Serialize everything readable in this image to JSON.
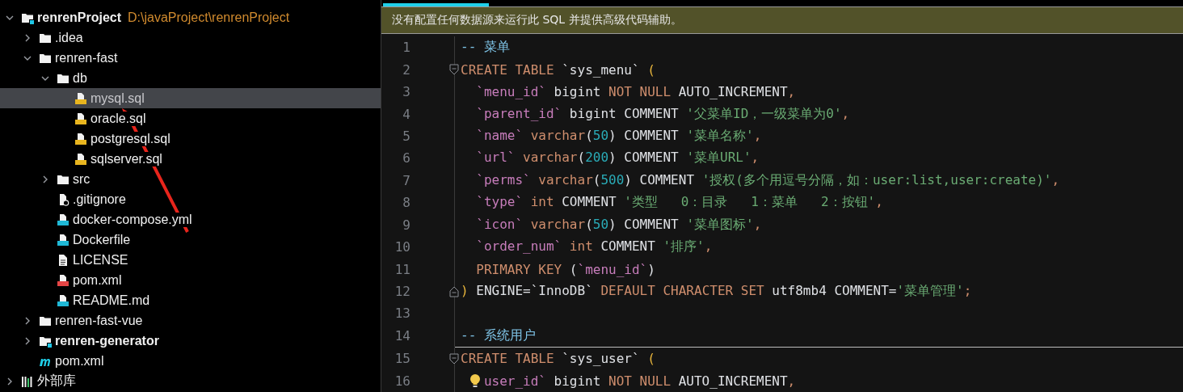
{
  "tree": [
    {
      "label": "renrenProject",
      "path": "D:\\javaProject\\renrenProject",
      "kind": "module",
      "expanded": true,
      "selected": false,
      "children": [
        {
          "label": ".idea",
          "kind": "folder",
          "expanded": false,
          "selected": false
        },
        {
          "label": "renren-fast",
          "kind": "folder",
          "expanded": true,
          "selected": false,
          "children": [
            {
              "label": "db",
              "kind": "folder",
              "expanded": true,
              "selected": false,
              "children": [
                {
                  "label": "mysql.sql",
                  "kind": "sql",
                  "selected": true
                },
                {
                  "label": "oracle.sql",
                  "kind": "sql",
                  "selected": false
                },
                {
                  "label": "postgresql.sql",
                  "kind": "sql",
                  "selected": false
                },
                {
                  "label": "sqlserver.sql",
                  "kind": "sql",
                  "selected": false
                }
              ]
            },
            {
              "label": "src",
              "kind": "folder",
              "expanded": false,
              "selected": false
            },
            {
              "label": ".gitignore",
              "kind": "ignore",
              "selected": false
            },
            {
              "label": "docker-compose.yml",
              "kind": "compose",
              "selected": false
            },
            {
              "label": "Dockerfile",
              "kind": "docker",
              "selected": false
            },
            {
              "label": "LICENSE",
              "kind": "text",
              "selected": false
            },
            {
              "label": "pom.xml",
              "kind": "xml",
              "selected": false
            },
            {
              "label": "README.md",
              "kind": "markdown",
              "selected": false
            }
          ]
        },
        {
          "label": "renren-fast-vue",
          "kind": "folder",
          "expanded": false,
          "selected": false
        },
        {
          "label": "renren-generator",
          "kind": "module",
          "expanded": false,
          "selected": false
        },
        {
          "label": "pom.xml",
          "kind": "maven",
          "selected": false
        }
      ]
    },
    {
      "label": "外部库",
      "kind": "library",
      "expanded": false,
      "selected": false
    }
  ],
  "banner": "没有配置任何数据源来运行此 SQL 并提供高级代码辅助。",
  "lines": [
    {
      "number": "1",
      "tokens": [
        {
          "kind": "comment",
          "t": "-- 菜单"
        }
      ]
    },
    {
      "number": "2",
      "fold_start": true,
      "tokens": [
        {
          "kind": "kw",
          "t": "CREATE TABLE "
        },
        {
          "kind": "plain",
          "t": "`sys_menu` "
        },
        {
          "kind": "paren",
          "t": "("
        }
      ]
    },
    {
      "number": "3",
      "tokens": [
        {
          "kind": "ident",
          "t": "  `menu_id`"
        },
        {
          "kind": "plain",
          "t": " bigint "
        },
        {
          "kind": "kw",
          "t": "NOT NULL"
        },
        {
          "kind": "plain",
          "t": " AUTO_INCREMENT"
        },
        {
          "kind": "punct",
          "t": ","
        }
      ]
    },
    {
      "number": "4",
      "tokens": [
        {
          "kind": "ident",
          "t": "  `parent_id`"
        },
        {
          "kind": "plain",
          "t": " bigint COMMENT "
        },
        {
          "kind": "str",
          "t": "'父菜单ID，一级菜单为0'"
        },
        {
          "kind": "punct",
          "t": ","
        }
      ]
    },
    {
      "number": "5",
      "tokens": [
        {
          "kind": "ident",
          "t": "  `name`"
        },
        {
          "kind": "kw",
          "t": " varchar"
        },
        {
          "kind": "plain",
          "t": "("
        },
        {
          "kind": "num",
          "t": "50"
        },
        {
          "kind": "plain",
          "t": ")"
        },
        {
          "kind": "plain",
          "t": " COMMENT "
        },
        {
          "kind": "str",
          "t": "'菜单名称'"
        },
        {
          "kind": "punct",
          "t": ","
        }
      ]
    },
    {
      "number": "6",
      "tokens": [
        {
          "kind": "ident",
          "t": "  `url`"
        },
        {
          "kind": "kw",
          "t": " varchar"
        },
        {
          "kind": "plain",
          "t": "("
        },
        {
          "kind": "num",
          "t": "200"
        },
        {
          "kind": "plain",
          "t": ")"
        },
        {
          "kind": "plain",
          "t": " COMMENT "
        },
        {
          "kind": "str",
          "t": "'菜单URL'"
        },
        {
          "kind": "punct",
          "t": ","
        }
      ]
    },
    {
      "number": "7",
      "tokens": [
        {
          "kind": "ident",
          "t": "  `perms`"
        },
        {
          "kind": "kw",
          "t": " varchar"
        },
        {
          "kind": "plain",
          "t": "("
        },
        {
          "kind": "num",
          "t": "500"
        },
        {
          "kind": "plain",
          "t": ")"
        },
        {
          "kind": "plain",
          "t": " COMMENT "
        },
        {
          "kind": "str",
          "t": "'授权(多个用逗号分隔，如：user:list,user:create)'"
        },
        {
          "kind": "punct",
          "t": ","
        }
      ]
    },
    {
      "number": "8",
      "tokens": [
        {
          "kind": "ident",
          "t": "  `type`"
        },
        {
          "kind": "kw",
          "t": " int"
        },
        {
          "kind": "plain",
          "t": " COMMENT "
        },
        {
          "kind": "str",
          "t": "'类型   0：目录   1：菜单   2：按钮'"
        },
        {
          "kind": "punct",
          "t": ","
        }
      ]
    },
    {
      "number": "9",
      "tokens": [
        {
          "kind": "ident",
          "t": "  `icon`"
        },
        {
          "kind": "kw",
          "t": " varchar"
        },
        {
          "kind": "plain",
          "t": "("
        },
        {
          "kind": "num",
          "t": "50"
        },
        {
          "kind": "plain",
          "t": ")"
        },
        {
          "kind": "plain",
          "t": " COMMENT "
        },
        {
          "kind": "str",
          "t": "'菜单图标'"
        },
        {
          "kind": "punct",
          "t": ","
        }
      ]
    },
    {
      "number": "10",
      "tokens": [
        {
          "kind": "ident",
          "t": "  `order_num`"
        },
        {
          "kind": "kw",
          "t": " int"
        },
        {
          "kind": "plain",
          "t": " COMMENT "
        },
        {
          "kind": "str",
          "t": "'排序'"
        },
        {
          "kind": "punct",
          "t": ","
        }
      ]
    },
    {
      "number": "11",
      "tokens": [
        {
          "kind": "kw",
          "t": "  PRIMARY KEY"
        },
        {
          "kind": "plain",
          "t": " ("
        },
        {
          "kind": "ident",
          "t": "`menu_id`"
        },
        {
          "kind": "plain",
          "t": ")"
        }
      ]
    },
    {
      "number": "12",
      "fold_end": true,
      "tokens": [
        {
          "kind": "paren",
          "t": ")"
        },
        {
          "kind": "plain",
          "t": " ENGINE=`InnoDB` "
        },
        {
          "kind": "kw",
          "t": "DEFAULT CHARACTER SET"
        },
        {
          "kind": "plain",
          "t": " utf8mb4 COMMENT="
        },
        {
          "kind": "str",
          "t": "'菜单管理'"
        },
        {
          "kind": "punct",
          "t": ";"
        }
      ]
    },
    {
      "number": "13"
    },
    {
      "number": "14",
      "tokens": [
        {
          "kind": "comment",
          "t": "-- 系统用户"
        }
      ]
    },
    {
      "number": "15",
      "fold_start": true,
      "separator": true,
      "tokens": [
        {
          "kind": "kw",
          "t": "CREATE TABLE "
        },
        {
          "kind": "plain",
          "t": "`sys_user` "
        },
        {
          "kind": "paren",
          "t": "("
        }
      ]
    },
    {
      "number": "16",
      "bulb": true,
      "tokens": [
        {
          "kind": "ident",
          "t": "user_id`"
        },
        {
          "kind": "plain",
          "t": " bigint "
        },
        {
          "kind": "kw",
          "t": "NOT NULL"
        },
        {
          "kind": "plain",
          "t": " AUTO_INCREMENT"
        },
        {
          "kind": "punct",
          "t": ","
        }
      ]
    }
  ]
}
